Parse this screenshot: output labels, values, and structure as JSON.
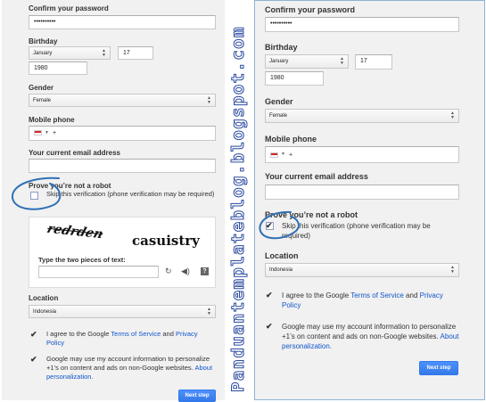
{
  "form": {
    "confirm_password_label": "Confirm your password",
    "password_mask": "••••••••••",
    "birthday_label": "Birthday",
    "birthday_month": "January",
    "birthday_day": "17",
    "birthday_year": "1980",
    "gender_label": "Gender",
    "gender_value": "Female",
    "mobile_label": "Mobile phone",
    "mobile_prefix": "+",
    "email_label": "Your current email address",
    "email_value": "",
    "robot_label": "Prove you’re not a robot",
    "skip_verification": "Skip this verification (phone verification may be required)",
    "captcha_word1": "redrden",
    "captcha_word2": "casuistry",
    "captcha_prompt": "Type the two pieces of text:",
    "captcha_input": "",
    "location_label": "Location",
    "location_value": "Indonesia",
    "agree_prefix": "I agree to the Google ",
    "terms_link": "Terms of Service",
    "agree_and": " and ",
    "privacy_link": "Privacy Policy",
    "personalize_text": "Google may use my account information to personalize +1’s on content and ads on non-Google websites. ",
    "personalize_link": "About personalization.",
    "next_step": "Next step"
  },
  "watermark": "Panduantemplateblog.blogspot.com",
  "colors": {
    "panel_bg": "#f1f1f1",
    "link": "#1155cc",
    "button": "#4d90fe",
    "annotation": "#2f6fb5"
  },
  "icons": {
    "dropdown": "chevron-updown-icon",
    "refresh": "refresh-icon",
    "audio": "speaker-icon",
    "help": "help-icon",
    "checkmark": "check-icon"
  }
}
